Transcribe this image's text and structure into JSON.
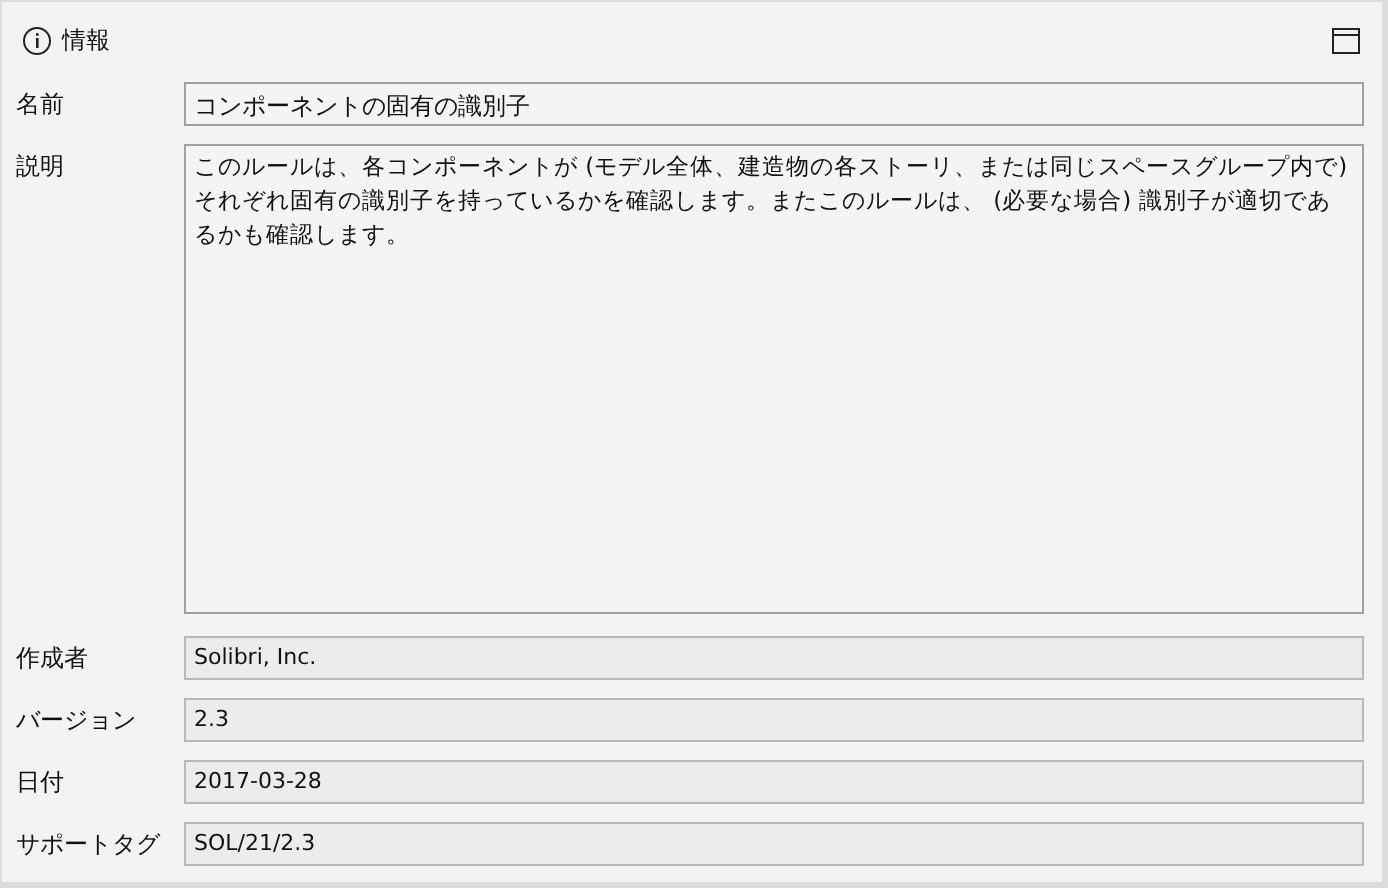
{
  "panel": {
    "title": "情報"
  },
  "fields": [
    {
      "label": "名前",
      "value": "コンポーネントの固有の識別子",
      "kind": "line",
      "readonly": false
    },
    {
      "label": "説明",
      "value": "このルールは、各コンポーネントが (モデル全体、建造物の各ストーリ、または同じスペースグループ内で) それぞれ固有の識別子を持っているかを確認します。またこのルールは、 (必要な場合) 識別子が適切であるかも確認します。",
      "kind": "area",
      "readonly": false
    },
    {
      "label": "作成者",
      "value": "Solibri, Inc.",
      "kind": "line",
      "readonly": true
    },
    {
      "label": "バージョン",
      "value": "2.3",
      "kind": "line",
      "readonly": true
    },
    {
      "label": "日付",
      "value": "2017-03-28",
      "kind": "line",
      "readonly": true
    },
    {
      "label": "サポートタグ",
      "value": "SOL/21/2.3",
      "kind": "line",
      "readonly": true
    }
  ]
}
